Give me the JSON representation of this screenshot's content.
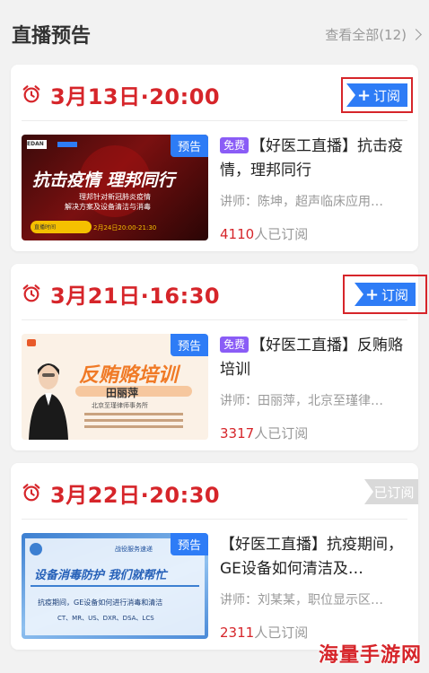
{
  "header": {
    "title": "直播预告",
    "view_all": "查看全部(12)"
  },
  "cards": [
    {
      "date": "3月13日·20:00",
      "button": "订阅",
      "tag": "预告",
      "free_label": "免费",
      "title": "【好医工直播】抗击疫情，理邦同行",
      "lecturer": "讲师：陈坤，超声临床应用…",
      "count": "4110",
      "count_suffix": "人已订阅",
      "thumb": {
        "brand": "EDAN",
        "headline": "抗击疫情 理邦同行",
        "line1": "理邦针对新冠肺炎疫情",
        "line2": "解决方案及设备清洁与消毒",
        "time_label": "直播时间",
        "time": "2月24日20:00-21:30"
      }
    },
    {
      "date": "3月21日·16:30",
      "button": "订阅",
      "tag": "预告",
      "free_label": "免费",
      "title": "【好医工直播】反贿赂培训",
      "lecturer": "讲师：田丽萍，北京至瑾律…",
      "count": "3317",
      "count_suffix": "人已订阅",
      "thumb": {
        "headline": "反贿赂培训",
        "name": "田丽萍",
        "org": "北京至瑾律师事务所"
      }
    },
    {
      "date": "3月22日·20:30",
      "button": "已订阅",
      "tag": "预告",
      "title": "【好医工直播】抗疫期间，GE设备如何清洁及…",
      "lecturer": "讲师：刘某某，职位显示区…",
      "count": "2311",
      "count_suffix": "人已订阅",
      "thumb": {
        "top_label": "战役服务速递",
        "headline": "设备消毒防护 我们就帮忙",
        "line1": "抗疫期间，GE设备如何进行消毒和清洁",
        "line2": "CT、MR、US、DXR、DSA、LCS"
      }
    }
  ],
  "watermark": "海量手游网",
  "colors": {
    "accent_red": "#d6252a",
    "button_blue": "#2e7cf6",
    "free_purple": "#8a5cf6",
    "subscribed_gray": "#d9d9d9"
  }
}
